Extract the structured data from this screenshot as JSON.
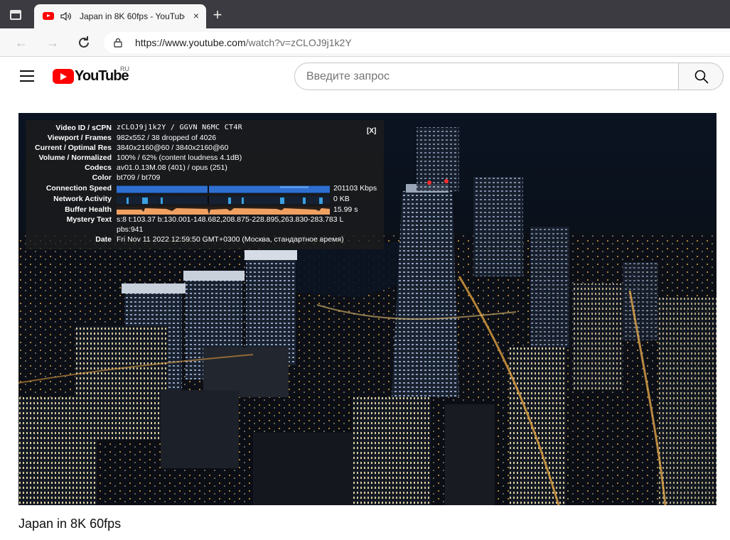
{
  "browser": {
    "tab_title": "Japan in 8K 60fps - YouTube",
    "tab_close": "×",
    "new_tab": "+",
    "url_host": "https://www.youtube.com",
    "url_path": "/watch?v=zCLOJ9j1k2Y"
  },
  "header": {
    "logo_text": "YouTube",
    "logo_region": "RU",
    "search_placeholder": "Введите запрос"
  },
  "stats": {
    "close": "[X]",
    "rows": [
      {
        "label": "Video ID / sCPN",
        "value": "zCLOJ9j1k2Y  /  GGVN  N6MC  CT4R"
      },
      {
        "label": "Viewport / Frames",
        "value": "982x552 / 38 dropped of 4026"
      },
      {
        "label": "Current / Optimal Res",
        "value": "3840x2160@60 / 3840x2160@60"
      },
      {
        "label": "Volume / Normalized",
        "value": "100% / 62% (content loudness 4.1dB)"
      },
      {
        "label": "Codecs",
        "value": "av01.0.13M.08 (401) / opus (251)"
      },
      {
        "label": "Color",
        "value": "bt709 / bt709"
      },
      {
        "label": "Connection Speed",
        "value": "201103 Kbps"
      },
      {
        "label": "Network Activity",
        "value": "0 KB"
      },
      {
        "label": "Buffer Health",
        "value": "15.99 s"
      },
      {
        "label": "Mystery Text",
        "value": "s:8 t:103.37 b:130.001-148.682,208.875-228.895,263.830-283.783 L",
        "value2": "pbs:941"
      },
      {
        "label": "Date",
        "value": "Fri Nov 11 2022 12:59:50 GMT+0300 (Москва, стандартное время)"
      }
    ]
  },
  "video": {
    "title": "Japan in 8K 60fps"
  },
  "colors": {
    "youtube_red": "#ff0000",
    "connection_graph": "#2f6fd0",
    "network_graph": "#3aa0e0",
    "buffer_graph": "#f0a060"
  }
}
